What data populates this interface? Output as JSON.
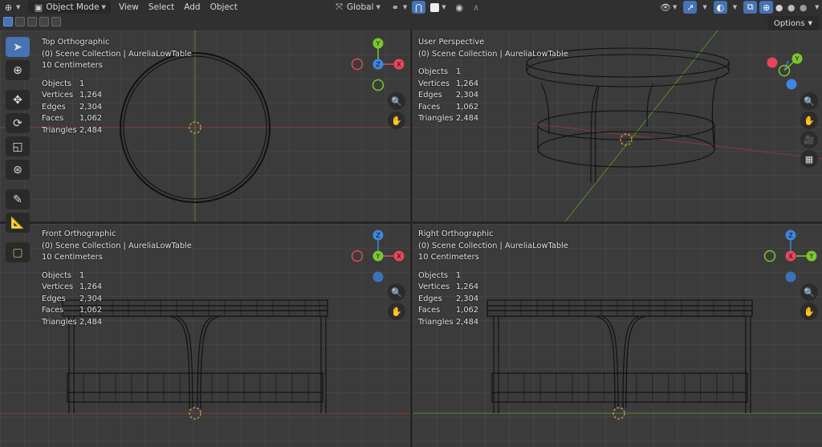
{
  "header": {
    "mode": "Object Mode",
    "menus": [
      "View",
      "Select",
      "Add",
      "Object"
    ],
    "orientation": "Global",
    "options_label": "Options"
  },
  "toolbar": [
    "select-box",
    "cursor",
    "move",
    "rotate",
    "scale",
    "transform",
    "annotate",
    "measure",
    "add-cube"
  ],
  "viewports": [
    {
      "title": "Top Orthographic",
      "collection": "(0) Scene Collection | AureliaLowTable",
      "scale": "10 Centimeters",
      "stats": [
        [
          "Objects",
          "1"
        ],
        [
          "Vertices",
          "1,264"
        ],
        [
          "Edges",
          "2,304"
        ],
        [
          "Faces",
          "1,062"
        ],
        [
          "Triangles",
          "2,484"
        ]
      ]
    },
    {
      "title": "User Perspective",
      "collection": "(0) Scene Collection | AureliaLowTable",
      "scale": "",
      "stats": [
        [
          "Objects",
          "1"
        ],
        [
          "Vertices",
          "1,264"
        ],
        [
          "Edges",
          "2,304"
        ],
        [
          "Faces",
          "1,062"
        ],
        [
          "Triangles",
          "2,484"
        ]
      ]
    },
    {
      "title": "Front Orthographic",
      "collection": "(0) Scene Collection | AureliaLowTable",
      "scale": "10 Centimeters",
      "stats": [
        [
          "Objects",
          "1"
        ],
        [
          "Vertices",
          "1,264"
        ],
        [
          "Edges",
          "2,304"
        ],
        [
          "Faces",
          "1,062"
        ],
        [
          "Triangles",
          "2,484"
        ]
      ]
    },
    {
      "title": "Right Orthographic",
      "collection": "(0) Scene Collection | AureliaLowTable",
      "scale": "10 Centimeters",
      "stats": [
        [
          "Objects",
          "1"
        ],
        [
          "Vertices",
          "1,264"
        ],
        [
          "Edges",
          "2,304"
        ],
        [
          "Faces",
          "1,062"
        ],
        [
          "Triangles",
          "2,484"
        ]
      ]
    }
  ],
  "gizmo_labels": {
    "x": "X",
    "y": "Y",
    "z": "Z"
  },
  "colors": {
    "accent": "#4772b3",
    "axis_x": "#e8465a",
    "axis_y": "#7bc72e",
    "axis_z": "#3f86e0"
  }
}
